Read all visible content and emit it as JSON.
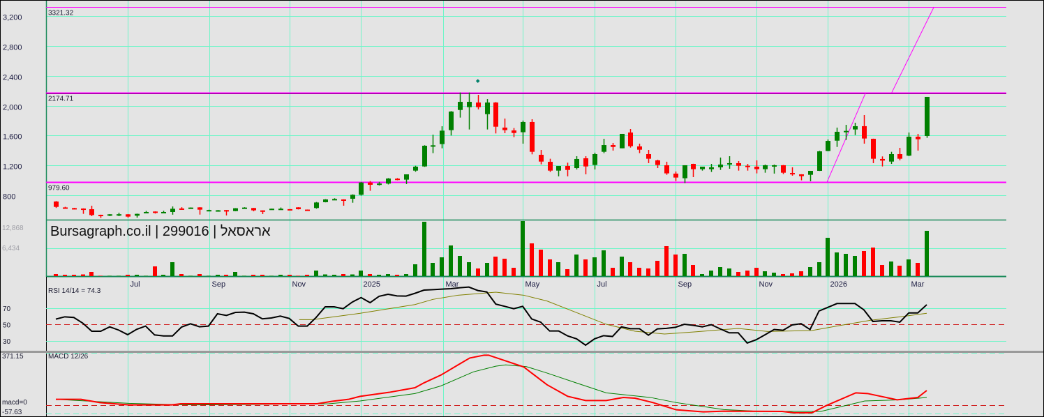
{
  "chart_data": {
    "type": "candlestick",
    "title": "Bursagraph.co.il | 299016 | אראסאל",
    "colors": {
      "up": "#008000",
      "down": "#ff0000",
      "grid": "#6ff5c8",
      "level": "#ff00ff",
      "rsi": "#000000",
      "rsi_signal": "#808000",
      "macd": "#ff0000",
      "macd_signal": "#008000",
      "background": "#e4e4e4"
    },
    "price_axis": {
      "ylim": [
        800,
        3200
      ],
      "ticks": [
        {
          "v": 3200,
          "label": "3,200"
        },
        {
          "v": 2800,
          "label": "2,800"
        },
        {
          "v": 2400,
          "label": "2,400"
        },
        {
          "v": 2000,
          "label": "2,000"
        },
        {
          "v": 1600,
          "label": "1,600"
        },
        {
          "v": 1200,
          "label": "1,200"
        },
        {
          "v": 800,
          "label": "800"
        }
      ]
    },
    "levels": [
      {
        "v": 3321.32,
        "label": "3321.32"
      },
      {
        "v": 2174.71,
        "label": "2174.71"
      },
      {
        "v": 979.6,
        "label": "979.60"
      }
    ],
    "trendlines": [
      {
        "from": [
          85.9,
          979.6
        ],
        "to": [
          90.2,
          2174.71
        ]
      },
      {
        "from": [
          93.1,
          2174.71
        ],
        "to": [
          97.8,
          3321.32
        ]
      }
    ],
    "dividend_marker": {
      "index": 47,
      "value": 2330
    },
    "months": [
      {
        "index": 8,
        "label": "Jul"
      },
      {
        "index": 17.1,
        "label": "Sep"
      },
      {
        "index": 26.0,
        "label": "Nov"
      },
      {
        "index": 34,
        "label": "2025"
      },
      {
        "index": 43.1,
        "label": "Mar"
      },
      {
        "index": 52,
        "label": "May"
      },
      {
        "index": 60,
        "label": "Jul"
      },
      {
        "index": 69.0,
        "label": "Sep"
      },
      {
        "index": 78.0,
        "label": "Nov"
      },
      {
        "index": 86,
        "label": "2026"
      },
      {
        "index": 95,
        "label": "Mar"
      }
    ],
    "ohlc": [
      [
        716,
        722,
        630,
        644
      ],
      [
        637,
        645,
        625,
        632
      ],
      [
        628,
        632,
        610,
        624
      ],
      [
        622,
        625,
        551,
        619
      ],
      [
        613,
        660,
        520,
        535
      ],
      [
        538,
        540,
        497,
        534
      ],
      [
        526,
        548,
        520,
        545
      ],
      [
        542,
        566,
        520,
        546
      ],
      [
        545,
        548,
        500,
        514
      ],
      [
        526,
        554,
        500,
        551
      ],
      [
        572,
        590,
        570,
        576
      ],
      [
        582,
        584,
        555,
        570
      ],
      [
        572,
        592,
        570,
        576
      ],
      [
        576,
        650,
        540,
        619
      ],
      [
        623,
        640,
        610,
        621
      ],
      [
        622,
        637,
        620,
        635
      ],
      [
        638,
        640,
        541,
        607
      ],
      [
        600,
        606,
        598,
        602
      ],
      [
        597,
        603,
        580,
        599
      ],
      [
        601,
        603,
        529,
        588
      ],
      [
        588,
        628,
        586,
        626
      ],
      [
        632,
        640,
        625,
        635
      ],
      [
        629,
        631,
        585,
        598
      ],
      [
        597,
        598,
        548,
        595
      ],
      [
        618,
        621,
        617,
        620
      ],
      [
        618,
        636,
        605,
        620
      ],
      [
        614,
        615,
        598,
        612
      ],
      [
        638,
        640,
        610,
        613
      ],
      [
        608,
        609,
        590,
        606
      ],
      [
        629,
        710,
        620,
        703
      ],
      [
        707,
        748,
        705,
        744
      ],
      [
        748,
        760,
        738,
        750
      ],
      [
        744,
        746,
        660,
        731
      ],
      [
        753,
        812,
        700,
        806
      ],
      [
        806,
        978,
        795,
        971
      ],
      [
        971,
        990,
        860,
        940
      ],
      [
        955,
        980,
        930,
        957
      ],
      [
        956,
        1030,
        945,
        1024
      ],
      [
        1022,
        1030,
        1000,
        1016
      ],
      [
        1009,
        1080,
        950,
        1080
      ],
      [
        1130,
        1195,
        1115,
        1183
      ],
      [
        1186,
        1470,
        1180,
        1463
      ],
      [
        1465,
        1611,
        1364,
        1469
      ],
      [
        1485,
        1724,
        1429,
        1665
      ],
      [
        1672,
        1927,
        1600,
        1921
      ],
      [
        1942,
        2176,
        1840,
        2051
      ],
      [
        1980,
        2176,
        1681,
        2051
      ],
      [
        2042,
        2145,
        1950,
        1980
      ],
      [
        1886,
        2088,
        1681,
        2042
      ],
      [
        2042,
        2048,
        1628,
        1718
      ],
      [
        1706,
        1827,
        1631,
        1672
      ],
      [
        1668,
        1700,
        1578,
        1634
      ],
      [
        1644,
        1800,
        1491,
        1781
      ],
      [
        1781,
        1818,
        1348,
        1382
      ],
      [
        1342,
        1407,
        1214,
        1251
      ],
      [
        1248,
        1289,
        1112,
        1130
      ],
      [
        1130,
        1192,
        1053,
        1192
      ],
      [
        1192,
        1236,
        1053,
        1139
      ],
      [
        1164,
        1323,
        1145,
        1286
      ],
      [
        1295,
        1323,
        1080,
        1186
      ],
      [
        1205,
        1370,
        1145,
        1351
      ],
      [
        1382,
        1556,
        1364,
        1472
      ],
      [
        1472,
        1500,
        1398,
        1447
      ],
      [
        1429,
        1622,
        1429,
        1622
      ],
      [
        1640,
        1687,
        1438,
        1457
      ],
      [
        1454,
        1491,
        1364,
        1410
      ],
      [
        1351,
        1407,
        1230,
        1289
      ],
      [
        1267,
        1276,
        1164,
        1205
      ],
      [
        1202,
        1249,
        1074,
        1093
      ],
      [
        1090,
        1118,
        990,
        1037
      ],
      [
        1028,
        1202,
        962,
        1202
      ],
      [
        1220,
        1222,
        1043,
        1149
      ],
      [
        1149,
        1183,
        1130,
        1183
      ],
      [
        1149,
        1220,
        1112,
        1174
      ],
      [
        1174,
        1305,
        1139,
        1211
      ],
      [
        1211,
        1323,
        1155,
        1230
      ],
      [
        1230,
        1258,
        1130,
        1195
      ],
      [
        1195,
        1220,
        1130,
        1192
      ],
      [
        1183,
        1267,
        1093,
        1149
      ],
      [
        1149,
        1211,
        1102,
        1202
      ],
      [
        1198,
        1211,
        1090,
        1202
      ],
      [
        1202,
        1205,
        1084,
        1102
      ],
      [
        1098,
        1174,
        1062,
        1096
      ],
      [
        1080,
        1082,
        1000,
        1056
      ],
      [
        1074,
        1127,
        987,
        1127
      ],
      [
        1127,
        1395,
        1125,
        1388
      ],
      [
        1392,
        1547,
        1390,
        1528
      ],
      [
        1531,
        1706,
        1447,
        1650
      ],
      [
        1658,
        1743,
        1541,
        1662
      ],
      [
        1681,
        1771,
        1606,
        1725
      ],
      [
        1725,
        1874,
        1491,
        1560
      ],
      [
        1556,
        1558,
        1230,
        1289
      ],
      [
        1286,
        1320,
        1186,
        1264
      ],
      [
        1251,
        1382,
        1220,
        1351
      ],
      [
        1351,
        1435,
        1267,
        1289
      ],
      [
        1330,
        1640,
        1323,
        1584
      ],
      [
        1584,
        1622,
        1398,
        1550
      ],
      [
        1594,
        2117,
        1569,
        2117
      ]
    ],
    "volume_axis": {
      "max": 12868,
      "labels": [
        {
          "v": 12868,
          "label": "12,868"
        },
        {
          "v": 6434,
          "label": "6,434"
        }
      ]
    },
    "volume": [
      483,
      322,
      322,
      400,
      965,
      100,
      100,
      100,
      322,
      322,
      100,
      2252,
      322,
      3217,
      483,
      100,
      483,
      100,
      322,
      322,
      965,
      100,
      322,
      322,
      100,
      322,
      322,
      100,
      322,
      1287,
      400,
      322,
      483,
      400,
      1287,
      483,
      322,
      483,
      322,
      483,
      2734,
      12546,
      3056,
      4343,
      7077,
      4665,
      3217,
      1769,
      3056,
      4504,
      4021,
      1930,
      12707,
      7560,
      6112,
      3860,
      3217,
      1608,
      4986,
      3860,
      4343,
      5951,
      1930,
      4504,
      3217,
      1930,
      1769,
      3539,
      6917,
      4986,
      5147,
      2574,
      483,
      1287,
      2091,
      1769,
      965,
      1287,
      1930,
      1126,
      804,
      483,
      643,
      1126,
      2091,
      3217,
      8847,
      5469,
      5147,
      4665,
      5791,
      6595,
      2574,
      3378,
      2413,
      3860,
      3056,
      10455
    ],
    "rsi": {
      "title": "RSI 14/14 = 74.3",
      "levels": [
        {
          "v": 70,
          "label": "70"
        },
        {
          "v": 50,
          "label": "50"
        },
        {
          "v": 30,
          "label": "30"
        }
      ],
      "values": [
        56.7,
        59.5,
        58.7,
        51.8,
        41.9,
        41.9,
        47.3,
        43.3,
        37.7,
        44.2,
        48.2,
        37.4,
        36.2,
        36.2,
        47.0,
        51.0,
        47.3,
        48.2,
        63.2,
        61.2,
        64.9,
        65.2,
        63.2,
        57.0,
        58.1,
        60.4,
        57.5,
        48.2,
        48.2,
        58.9,
        71.7,
        71.7,
        69.4,
        77.4,
        83.0,
        76.8,
        84.5,
        87.0,
        85.0,
        84.8,
        88.2,
        92.1,
        92.7,
        93.3,
        93.8,
        95.0,
        95.8,
        91.6,
        89.9,
        75.0,
        72.3,
        69.4,
        72.3,
        56.9,
        53.0,
        42.2,
        42.2,
        36.2,
        32.6,
        24.9,
        32.6,
        36.5,
        35.5,
        47.3,
        45.0,
        45.0,
        37.1,
        44.8,
        45.4,
        46.7,
        50.4,
        49.1,
        47.3,
        49.9,
        44.8,
        40.0,
        40.0,
        27.5,
        31.5,
        37.7,
        44.0,
        43.1,
        49.6,
        51.1,
        44.0,
        66.6,
        71.1,
        75.7,
        75.7,
        75.7,
        68.0,
        53.8,
        54.7,
        54.7,
        53.0,
        64.3,
        64.3,
        74.3
      ],
      "signal": [
        [
          27.1,
          56.1
        ],
        [
          28.6,
          56.1
        ],
        [
          33.9,
          63.8
        ],
        [
          40.0,
          74.5
        ],
        [
          42.0,
          80.8
        ],
        [
          44.8,
          85.9
        ],
        [
          49.0,
          89.6
        ],
        [
          52.1,
          85.9
        ],
        [
          54.7,
          78.8
        ],
        [
          58.0,
          64.6
        ],
        [
          61.3,
          50.4
        ],
        [
          64.5,
          41.9
        ],
        [
          67.8,
          38.5
        ],
        [
          71.1,
          41.1
        ],
        [
          76.0,
          45.3
        ],
        [
          79.3,
          41.6
        ],
        [
          84.2,
          42.8
        ],
        [
          87.4,
          49.0
        ],
        [
          90.7,
          55.2
        ],
        [
          94.0,
          59.5
        ],
        [
          97,
          63.8
        ]
      ]
    },
    "macd": {
      "title": "MACD 12/26",
      "ylim": [
        -57.63,
        371.15
      ],
      "labels": {
        "max": "371.15",
        "zero": "macd=0",
        "min": "-57.63"
      },
      "macd": [
        [
          0,
          40.7
        ],
        [
          2.8,
          40.7
        ],
        [
          4.9,
          17.9
        ],
        [
          8.1,
          1.6
        ],
        [
          12.9,
          1.6
        ],
        [
          13.9,
          9.8
        ],
        [
          29.1,
          9.8
        ],
        [
          30.7,
          26.0
        ],
        [
          32.6,
          40.7
        ],
        [
          33.9,
          61.8
        ],
        [
          37.1,
          89.5
        ],
        [
          40.0,
          122
        ],
        [
          41.0,
          156
        ],
        [
          42.9,
          211
        ],
        [
          44.8,
          282
        ],
        [
          46.1,
          330
        ],
        [
          47.7,
          350
        ],
        [
          48.2,
          350
        ],
        [
          52.1,
          268
        ],
        [
          54.7,
          143
        ],
        [
          57.0,
          62
        ],
        [
          59.0,
          32.6
        ],
        [
          61.3,
          32.6
        ],
        [
          63.2,
          53.7
        ],
        [
          64.5,
          48.8
        ],
        [
          66.5,
          17.9
        ],
        [
          69.1,
          -32.6
        ],
        [
          72.1,
          -47.2
        ],
        [
          74.4,
          -42.3
        ],
        [
          80.9,
          -43.9
        ],
        [
          82.2,
          -53.7
        ],
        [
          84.2,
          -53.7
        ],
        [
          85.8,
          -3.3
        ],
        [
          89.1,
          86.3
        ],
        [
          90.4,
          81.4
        ],
        [
          93.7,
          37.4
        ],
        [
          96.0,
          53.7
        ],
        [
          97,
          102.5
        ]
      ],
      "signal": [
        [
          0,
          40.7
        ],
        [
          8.1,
          13
        ],
        [
          12.5,
          4.9
        ],
        [
          15.6,
          1.6
        ],
        [
          30.4,
          9.8
        ],
        [
          33.9,
          29.3
        ],
        [
          40.0,
          81.4
        ],
        [
          42.9,
          135
        ],
        [
          46.5,
          233
        ],
        [
          49.0,
          273
        ],
        [
          50.1,
          282
        ],
        [
          52.4,
          270
        ],
        [
          54.7,
          225
        ],
        [
          58.0,
          155
        ],
        [
          61.3,
          86
        ],
        [
          66.2,
          54
        ],
        [
          69.1,
          18
        ],
        [
          74.4,
          -31
        ],
        [
          77.6,
          -41
        ],
        [
          80.9,
          -43.9
        ],
        [
          85.2,
          -43.9
        ],
        [
          90.1,
          29.3
        ],
        [
          94.0,
          37.4
        ],
        [
          97,
          53.7
        ]
      ]
    }
  }
}
